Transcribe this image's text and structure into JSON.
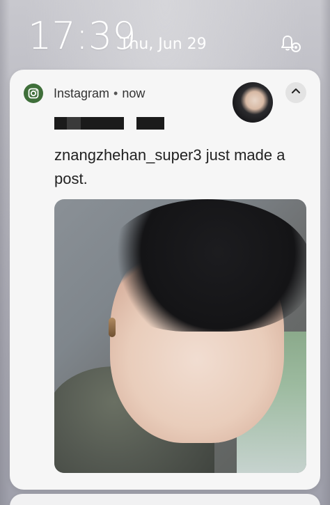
{
  "status": {
    "time": "17:39",
    "date": "Thu, Jun 29"
  },
  "notification": {
    "app_name": "Instagram",
    "separator": "•",
    "timestamp": "now",
    "message": "znangzhehan_super3 just made a post.",
    "icons": {
      "app": "instagram-icon",
      "expand": "chevron-up-icon",
      "settings": "notification-settings-icon"
    }
  },
  "colors": {
    "card_bg": "#f6f6f6",
    "app_icon_bg": "#3f6f3a",
    "text_primary": "#222222"
  }
}
